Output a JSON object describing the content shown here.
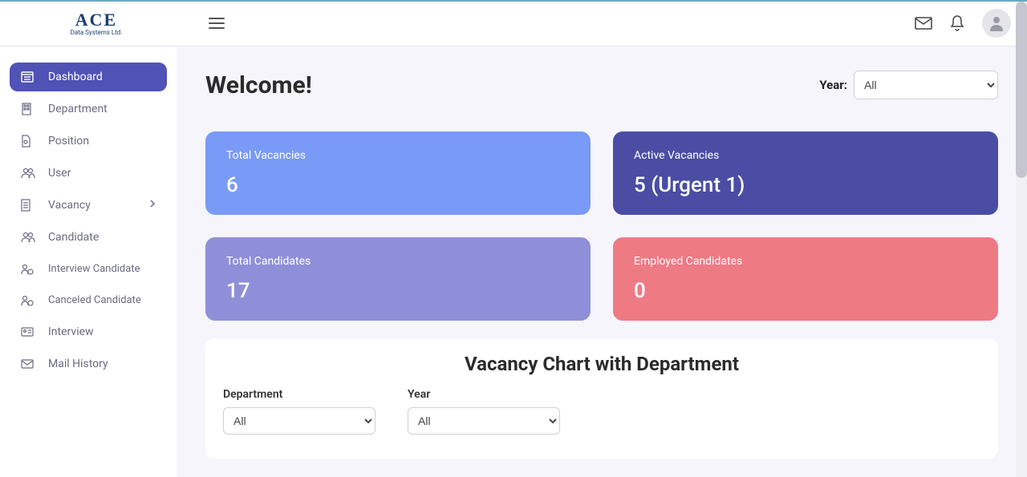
{
  "header": {
    "logo_main": "ACE",
    "logo_sub": "Data Systems Ltd."
  },
  "sidebar": {
    "items": [
      {
        "label": "Dashboard"
      },
      {
        "label": "Department"
      },
      {
        "label": "Position"
      },
      {
        "label": "User"
      },
      {
        "label": "Vacancy"
      },
      {
        "label": "Candidate"
      },
      {
        "label": "Interview Candidate"
      },
      {
        "label": "Canceled Candidate"
      },
      {
        "label": "Interview"
      },
      {
        "label": "Mail History"
      }
    ]
  },
  "main": {
    "welcome": "Welcome!",
    "year_label": "Year:",
    "year_value": "All",
    "cards": {
      "total_vacancies_label": "Total Vacancies",
      "total_vacancies_value": "6",
      "active_vacancies_label": "Active Vacancies",
      "active_vacancies_value": "5 (Urgent 1)",
      "total_candidates_label": "Total Candidates",
      "total_candidates_value": "17",
      "employed_candidates_label": "Employed Candidates",
      "employed_candidates_value": "0"
    },
    "chart": {
      "title": "Vacancy Chart with Department",
      "department_label": "Department",
      "department_value": "All",
      "year_label": "Year",
      "year_value": "All"
    }
  }
}
